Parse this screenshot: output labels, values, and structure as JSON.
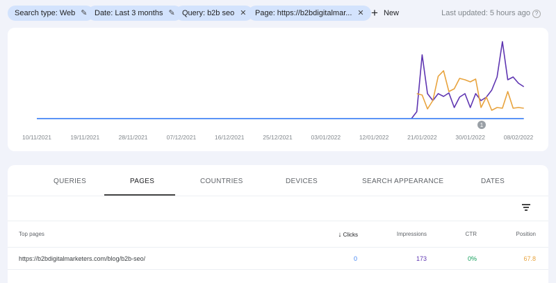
{
  "filters": [
    {
      "label": "Search type: Web",
      "icon": "pencil-icon"
    },
    {
      "label": "Date: Last 3 months",
      "icon": "pencil-icon"
    },
    {
      "label": "Query: b2b seo",
      "icon": "close-icon"
    },
    {
      "label": "Page: https://b2bdigitalmar...",
      "icon": "close-icon"
    }
  ],
  "new_label": "New",
  "last_updated": "Last updated: 5 hours ago",
  "chart_data": {
    "type": "line",
    "x_ticks": [
      "10/11/2021",
      "19/11/2021",
      "28/11/2021",
      "07/12/2021",
      "16/12/2021",
      "25/12/2021",
      "03/01/2022",
      "12/01/2022",
      "21/01/2022",
      "30/01/2022",
      "08/02/2022"
    ],
    "x_range_days": [
      0,
      91
    ],
    "annotation": "1",
    "series": [
      {
        "name": "Clicks",
        "color": "#4285f4",
        "start_day": 0,
        "values": [
          0,
          0,
          0,
          0,
          0,
          0,
          0,
          0,
          0,
          0,
          0,
          0,
          0,
          0,
          0,
          0,
          0,
          0,
          0,
          0,
          0,
          0,
          0,
          0,
          0,
          0,
          0,
          0,
          0,
          0,
          0,
          0,
          0,
          0,
          0,
          0,
          0,
          0,
          0,
          0,
          0,
          0,
          0,
          0,
          0,
          0,
          0,
          0,
          0,
          0,
          0,
          0,
          0,
          0,
          0,
          0,
          0,
          0,
          0,
          0,
          0,
          0,
          0,
          0,
          0,
          0,
          0,
          0,
          0,
          0,
          0,
          0,
          0,
          0,
          0,
          0,
          0,
          0,
          0,
          0,
          0,
          0,
          0,
          0,
          0,
          0,
          0,
          0,
          0,
          0,
          0,
          0
        ]
      },
      {
        "name": "Impressions",
        "color": "#5e35b1",
        "start_day": 70,
        "values": [
          0,
          10,
          92,
          36,
          26,
          36,
          32,
          37,
          16,
          31,
          36,
          16,
          36,
          26,
          31,
          41,
          60,
          111,
          56,
          60,
          51,
          46
        ]
      },
      {
        "name": "Position",
        "color": "#e8a33d",
        "start_day": 71,
        "values": [
          36,
          34,
          14,
          26,
          61,
          69,
          39,
          43,
          58,
          56,
          53,
          57,
          16,
          31,
          12,
          16,
          15,
          39,
          15,
          16,
          15
        ]
      }
    ]
  },
  "tabs": [
    "QUERIES",
    "PAGES",
    "COUNTRIES",
    "DEVICES",
    "SEARCH APPEARANCE",
    "DATES"
  ],
  "active_tab": "PAGES",
  "table": {
    "headers": {
      "page": "Top pages",
      "clicks": "Clicks",
      "impressions": "Impressions",
      "ctr": "CTR",
      "position": "Position"
    },
    "rows": [
      {
        "page": "https://b2bdigitalmarketers.com/blog/b2b-seo/",
        "clicks": "0",
        "impressions": "173",
        "ctr": "0%",
        "position": "67.8"
      }
    ]
  },
  "colors": {
    "clicks": "#4285f4",
    "impressions": "#5e35b1",
    "ctr": "#0f9d58",
    "position": "#e8710a"
  }
}
